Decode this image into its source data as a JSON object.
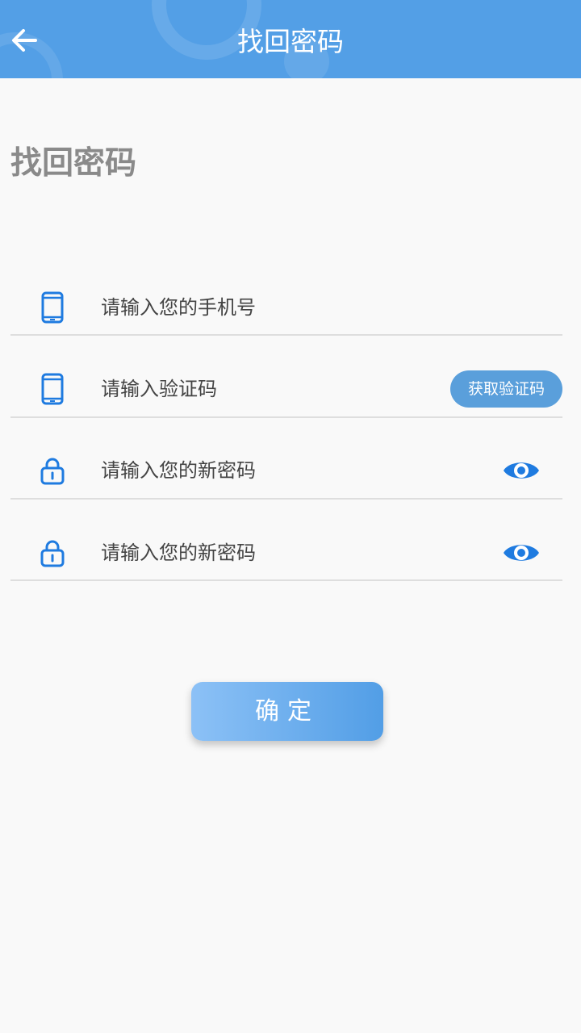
{
  "header": {
    "title": "找回密码",
    "back_icon": "arrow-left-icon",
    "background": "#539fe6"
  },
  "page": {
    "title": "找回密码"
  },
  "form": {
    "phone": {
      "placeholder": "请输入您的手机号",
      "icon": "phone-icon"
    },
    "code": {
      "placeholder": "请输入验证码",
      "icon": "phone-icon",
      "button_label": "获取验证码"
    },
    "new_password": {
      "placeholder": "请输入您的新密码",
      "icon": "lock-icon",
      "toggle_icon": "eye-icon"
    },
    "confirm_password": {
      "placeholder": "请输入您的新密码",
      "icon": "lock-icon",
      "toggle_icon": "eye-icon"
    }
  },
  "submit": {
    "label": "确定"
  },
  "colors": {
    "accent": "#539fe6",
    "icon_blue": "#1f7be0",
    "code_button": "#5a9fdb",
    "background": "#f9f9f9"
  }
}
